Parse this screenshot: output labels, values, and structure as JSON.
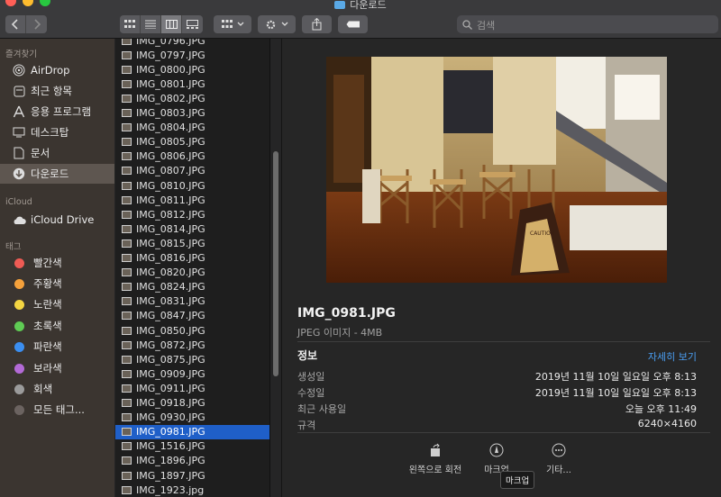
{
  "window": {
    "title": "다운로드"
  },
  "toolbar": {
    "search_placeholder": "검색",
    "icons": [
      "back-icon",
      "forward-icon",
      "icon-view",
      "list-view",
      "column-view",
      "gallery-view",
      "group-icon",
      "gear-icon",
      "share-icon",
      "tag-icon",
      "search-icon"
    ]
  },
  "sidebar": {
    "favorites_header": "즐겨찾기",
    "favorites": [
      {
        "label": "AirDrop",
        "icon": "airdrop-icon"
      },
      {
        "label": "최근 항목",
        "icon": "recents-icon"
      },
      {
        "label": "응용 프로그램",
        "icon": "applications-icon"
      },
      {
        "label": "데스크탑",
        "icon": "desktop-icon"
      },
      {
        "label": "문서",
        "icon": "document-icon"
      },
      {
        "label": "다운로드",
        "icon": "downloads-icon"
      }
    ],
    "icloud_header": "iCloud",
    "icloud": [
      {
        "label": "iCloud Drive",
        "icon": "cloud-icon"
      }
    ],
    "tags_header": "태그",
    "tags": [
      {
        "label": "빨간색",
        "color": "#ef5b54"
      },
      {
        "label": "주황색",
        "color": "#f5a13b"
      },
      {
        "label": "노란색",
        "color": "#f4d542"
      },
      {
        "label": "초록색",
        "color": "#5fcb54"
      },
      {
        "label": "파란색",
        "color": "#3b8ef0"
      },
      {
        "label": "보라색",
        "color": "#b36ad6"
      },
      {
        "label": "회색",
        "color": "#9b9b9b"
      },
      {
        "label": "모든 태그...",
        "color": "#6b6360"
      }
    ]
  },
  "files": {
    "selected": "IMG_0981.JPG",
    "items": [
      "IMG_0796.JPG",
      "IMG_0797.JPG",
      "IMG_0800.JPG",
      "IMG_0801.JPG",
      "IMG_0802.JPG",
      "IMG_0803.JPG",
      "IMG_0804.JPG",
      "IMG_0805.JPG",
      "IMG_0806.JPG",
      "IMG_0807.JPG",
      "IMG_0810.JPG",
      "IMG_0811.JPG",
      "IMG_0812.JPG",
      "IMG_0814.JPG",
      "IMG_0815.JPG",
      "IMG_0816.JPG",
      "IMG_0820.JPG",
      "IMG_0824.JPG",
      "IMG_0831.JPG",
      "IMG_0847.JPG",
      "IMG_0850.JPG",
      "IMG_0872.JPG",
      "IMG_0875.JPG",
      "IMG_0909.JPG",
      "IMG_0911.JPG",
      "IMG_0918.JPG",
      "IMG_0930.JPG",
      "IMG_0981.JPG",
      "IMG_1516.JPG",
      "IMG_1896.JPG",
      "IMG_1897.JPG",
      "IMG_1923.jpg"
    ]
  },
  "preview": {
    "filename": "IMG_0981.JPG",
    "type_size": "JPEG 이미지 - 4MB",
    "info_header": "정보",
    "more_link": "자세히 보기",
    "info": [
      {
        "key": "생성일",
        "value": "2019년 11월 10일 일요일 오후 8:13"
      },
      {
        "key": "수정일",
        "value": "2019년 11월 10일 일요일 오후 8:13"
      },
      {
        "key": "최근 사용일",
        "value": "오늘 오후 11:49"
      },
      {
        "key": "규격",
        "value": "6240×4160"
      }
    ],
    "actions": [
      {
        "label": "왼쪽으로 회전",
        "icon": "rotate-left-icon"
      },
      {
        "label": "마크업",
        "icon": "markup-icon"
      },
      {
        "label": "기타...",
        "icon": "more-icon"
      }
    ],
    "tooltip": "마크업",
    "photo_sign": "CAUTION"
  },
  "colors": {
    "accent": "#1f5fc8",
    "link": "#4a9df0",
    "sidebar_bg": "#3b3530"
  }
}
